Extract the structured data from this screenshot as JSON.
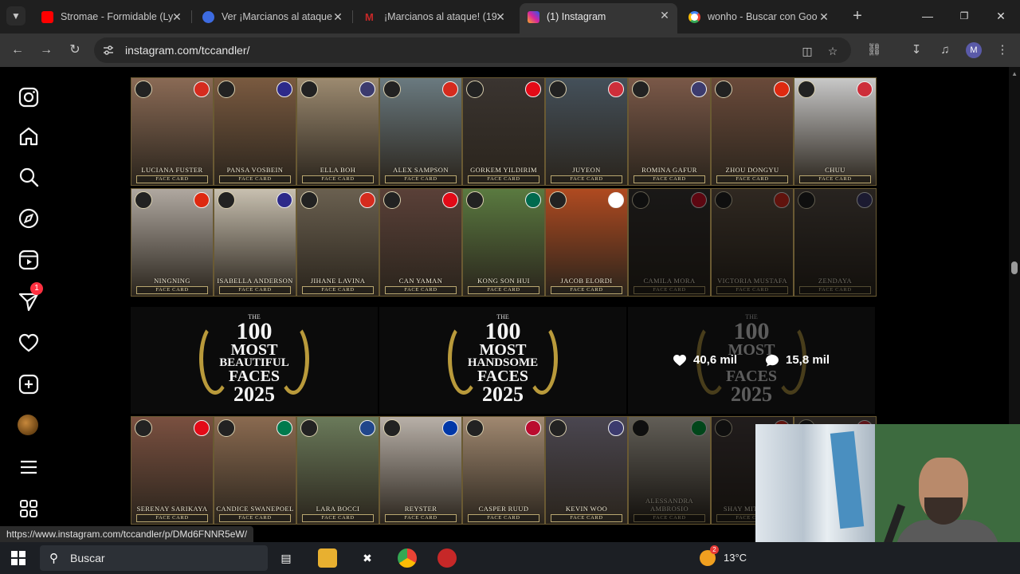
{
  "browser": {
    "tabs": [
      {
        "title": "Stromae - Formidable (Ly",
        "favicon_color": "#ff0000",
        "favicon": "youtube-icon"
      },
      {
        "title": "Ver ¡Marcianos al ataque",
        "favicon_color": "#3d6be0",
        "favicon": "site-icon"
      },
      {
        "title": "¡Marcianos al ataque! (1⁠9",
        "favicon_color": "#c62828",
        "favicon": "m-icon"
      },
      {
        "title": "(1) Instagram",
        "favicon_color": "#d6249f",
        "favicon": "instagram-icon",
        "active": true
      },
      {
        "title": "wonho - Buscar con Goo",
        "favicon_color": "#ffffff",
        "favicon": "google-icon"
      }
    ],
    "url": "instagram.com/tccandler/",
    "profile_initial": "M"
  },
  "instagram": {
    "notification_count": "1",
    "nav": [
      "instagram-logo",
      "home",
      "search",
      "explore",
      "reels",
      "messages",
      "notifications",
      "create",
      "profile",
      "more",
      "also-from-meta"
    ]
  },
  "grid": {
    "row1": [
      {
        "name": "LUCIANA FUSTER",
        "flag": "#d52b1e",
        "bg": "#8a6a55"
      },
      {
        "name": "PANSA VOSBEIN",
        "flag": "#2d2a8a",
        "bg": "#7a5a40"
      },
      {
        "name": "ELLA BOH",
        "flag": "#3c3b6e",
        "bg": "#9c8a70"
      },
      {
        "name": "ALEX SAMPSON",
        "flag": "#d52b1e",
        "bg": "#6a7a80"
      },
      {
        "name": "GORKEM YILDIRIM",
        "flag": "#e30a17",
        "bg": "#3a3430"
      },
      {
        "name": "JUYEON",
        "flag": "#cd2e3a",
        "bg": "#44505a"
      },
      {
        "name": "ROMINA GAFUR",
        "flag": "#3c3b6e",
        "bg": "#7a5848"
      },
      {
        "name": "ZHOU DONGYU",
        "flag": "#de2910",
        "bg": "#6a4a3a"
      },
      {
        "name": "CHUU",
        "flag": "#cd2e3a",
        "bg": "#c8c8c8"
      }
    ],
    "row2": [
      {
        "name": "NINGNING",
        "flag": "#de2910",
        "bg": "#b0a8a0"
      },
      {
        "name": "ISABELLA ANDERSON",
        "flag": "#2d2a8a",
        "bg": "#c8c0b0"
      },
      {
        "name": "JIHANE LAVINA",
        "flag": "#d52b1e",
        "bg": "#6a6050"
      },
      {
        "name": "CAN YAMAN",
        "flag": "#e30a17",
        "bg": "#5a4038"
      },
      {
        "name": "KONG SON HUI",
        "flag": "#006a4e",
        "bg": "#5a7a40"
      },
      {
        "name": "JACOB ELORDI",
        "flag": "#ffffff",
        "bg": "#b04a20"
      },
      {
        "name": "CAMILA MORA",
        "flag": "#ce1126",
        "bg": "#3a3634",
        "dim": true
      },
      {
        "name": "VICTORIA MUSTAFA",
        "flag": "#d52b1e",
        "bg": "#6a5a4a",
        "dim": true
      },
      {
        "name": "ZENDAYA",
        "flag": "#3c3b6e",
        "bg": "#5a5048",
        "dim": true
      }
    ],
    "posts": [
      {
        "kind": "BEAUTIFUL",
        "the": "THE",
        "num": "100",
        "most": "MOST",
        "faces": "FACES",
        "year": "2025"
      },
      {
        "kind": "HANDSOME",
        "the": "THE",
        "num": "100",
        "most": "MOST",
        "faces": "FACES",
        "year": "2025"
      },
      {
        "kind": "",
        "the": "THE",
        "num": "100",
        "most": "MOST",
        "faces": "FACES",
        "year": "2025",
        "likes": "40,6 mil",
        "comments": "15,8 mil"
      }
    ],
    "row3": [
      {
        "name": "SERENAY SARIKAYA",
        "flag": "#e30a17",
        "bg": "#7a5040"
      },
      {
        "name": "CANDICE SWANEPOEL",
        "flag": "#007a4d",
        "bg": "#8a6a50"
      },
      {
        "name": "LARA BOCCI",
        "flag": "#21468b",
        "bg": "#6a7a5a"
      },
      {
        "name": "REYSTER",
        "flag": "#0038a8",
        "bg": "#b8b0a8"
      },
      {
        "name": "CASPER RUUD",
        "flag": "#ba0c2f",
        "bg": "#a08870"
      },
      {
        "name": "KEVIN WOO",
        "flag": "#3c3b6e",
        "bg": "#4a4650"
      },
      {
        "name": "ALESSANDRA AMBROSIO",
        "flag": "#009c3b",
        "bg": "#d8d0c0",
        "dim": true
      },
      {
        "name": "SHAY MITCHELL",
        "flag": "#d52b1e",
        "bg": "#4a4040",
        "dim": true
      },
      {
        "name": "",
        "flag": "#cd2e3a",
        "bg": "#5a5048",
        "dim": true
      }
    ],
    "face_card": "FACE CARD"
  },
  "status_url": "https://www.instagram.com/tccandler/p/DMd6FNNR5eW/",
  "taskbar": {
    "search_placeholder": "Buscar",
    "temperature": "13°C",
    "weather_badge": "2"
  }
}
